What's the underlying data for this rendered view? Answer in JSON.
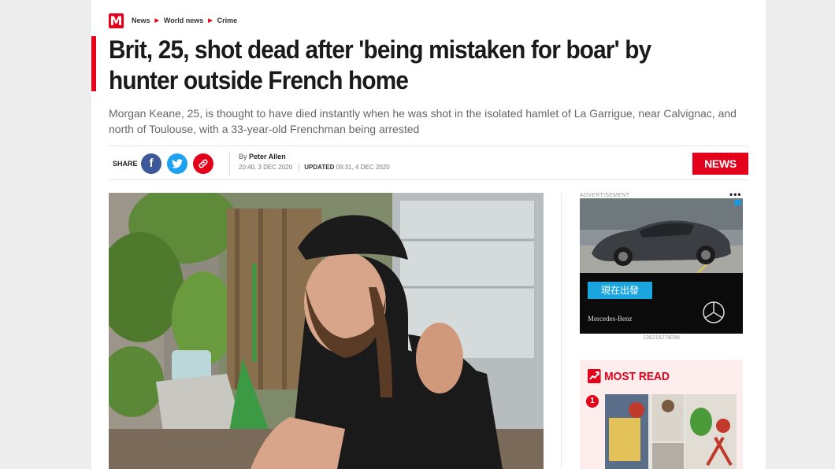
{
  "breadcrumb": {
    "logo": "M",
    "items": [
      "News",
      "World news",
      "Crime"
    ]
  },
  "article": {
    "headline": "Brit, 25, shot dead after 'being mistaken for boar' by hunter outside French home",
    "standfirst": "Morgan Keane, 25, is thought to have died instantly when he was shot in the isolated hamlet of La Garrigue, near Calvignac, and north of Toulouse, with a 33-year-old Frenchman being arrested"
  },
  "share": {
    "label": "SHARE",
    "facebook_glyph": "f",
    "twitter_glyph": "🐦",
    "link_glyph": "🔗"
  },
  "byline": {
    "prefix": "By",
    "author": "Peter Allen",
    "published": "20:40, 3 DEC 2020",
    "updated_label": "UPDATED",
    "updated": "09:31, 4 DEC 2020"
  },
  "section_badge": "NEWS",
  "advert": {
    "label": "ADVERTISEMENT",
    "dots": "•••",
    "cta": "現在出發",
    "brand": "Mercedes-Benz",
    "id": "138216278096"
  },
  "most_read": {
    "title": "MOST READ",
    "first_rank": "1"
  },
  "colors": {
    "brand_red": "#e4001b",
    "facebook": "#3b5998",
    "twitter": "#1da1f2",
    "ad_cta": "#1aa5df"
  }
}
